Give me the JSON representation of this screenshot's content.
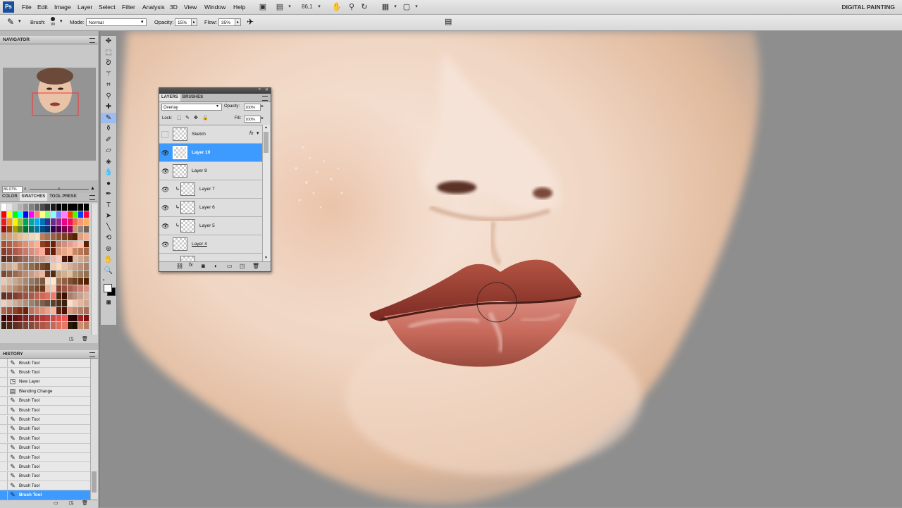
{
  "menubar": {
    "logo": "Ps",
    "items": [
      "File",
      "Edit",
      "Image",
      "Layer",
      "Select",
      "Filter",
      "Analysis",
      "3D",
      "View",
      "Window",
      "Help"
    ],
    "zoom": "86,1",
    "workspace": "DIGITAL PAINTING"
  },
  "options": {
    "brush_label": "Brush:",
    "brush_size": "90",
    "mode_label": "Mode:",
    "mode_value": "Normal",
    "opacity_label": "Opacity:",
    "opacity_value": "15%",
    "flow_label": "Flow:",
    "flow_value": "35%"
  },
  "navigator": {
    "title": "NAVIGATOR",
    "zoom": "86.07%"
  },
  "swatches": {
    "tabs": [
      "COLOR",
      "SWATCHES",
      "TOOL PRESE"
    ],
    "active_tab": "SWATCHES"
  },
  "history": {
    "title": "HISTORY",
    "items": [
      {
        "label": "Brush Tool",
        "icon": "brush-icon"
      },
      {
        "label": "Brush Tool",
        "icon": "brush-icon"
      },
      {
        "label": "New Layer",
        "icon": "new-layer-icon"
      },
      {
        "label": "Blending Change",
        "icon": "blending-icon"
      },
      {
        "label": "Brush Tool",
        "icon": "brush-icon"
      },
      {
        "label": "Brush Tool",
        "icon": "brush-icon"
      },
      {
        "label": "Brush Tool",
        "icon": "brush-icon"
      },
      {
        "label": "Brush Tool",
        "icon": "brush-icon"
      },
      {
        "label": "Brush Tool",
        "icon": "brush-icon"
      },
      {
        "label": "Brush Tool",
        "icon": "brush-icon"
      },
      {
        "label": "Brush Tool",
        "icon": "brush-icon"
      },
      {
        "label": "Brush Tool",
        "icon": "brush-icon"
      },
      {
        "label": "Brush Tool",
        "icon": "brush-icon"
      },
      {
        "label": "Brush Tool",
        "icon": "brush-icon"
      },
      {
        "label": "Brush Tool",
        "icon": "brush-icon"
      }
    ],
    "selected_index": 14
  },
  "layers_panel": {
    "tabs": [
      "LAYERS",
      "BRUSHES"
    ],
    "blend_mode": "Overlay",
    "opacity_label": "Opacity:",
    "opacity_value": "100%",
    "lock_label": "Lock:",
    "fill_label": "Fill:",
    "fill_value": "100%",
    "layers": [
      {
        "name": "Sketch",
        "visible": false,
        "clipped": false,
        "fx": true
      },
      {
        "name": "Layer 10",
        "visible": true,
        "clipped": false,
        "selected": true
      },
      {
        "name": "Layer 8",
        "visible": true,
        "clipped": false
      },
      {
        "name": "Layer 7",
        "visible": true,
        "clipped": true
      },
      {
        "name": "Layer 6",
        "visible": true,
        "clipped": true
      },
      {
        "name": "Layer 5",
        "visible": true,
        "clipped": true
      },
      {
        "name": "Layer 4",
        "visible": true,
        "clipped": false
      }
    ],
    "fx_symbol": "fx"
  },
  "colors": {
    "selection_blue": "#3d9bff",
    "ps_blue": "#1a4f9e"
  }
}
